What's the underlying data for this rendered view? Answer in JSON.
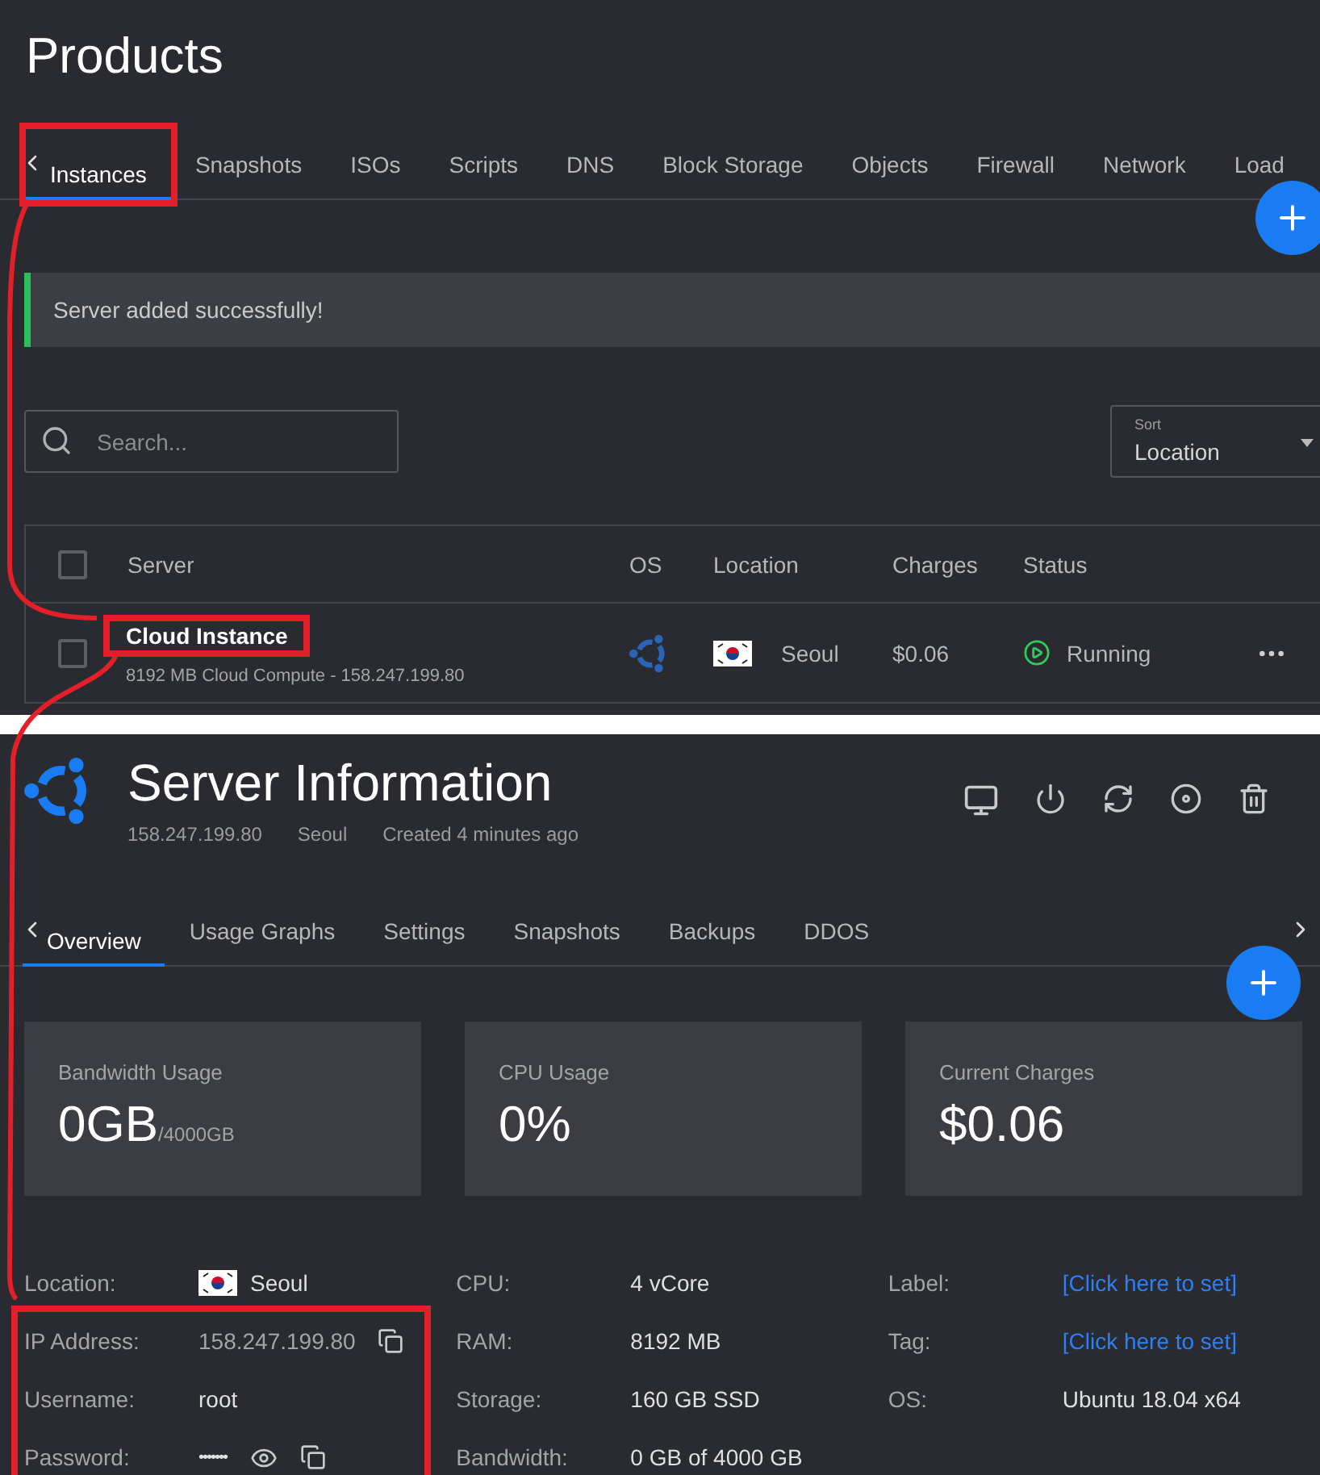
{
  "products": {
    "title": "Products",
    "tabs": [
      {
        "label": "Instances",
        "selected": true,
        "highlighted": true
      },
      {
        "label": "Snapshots",
        "selected": false,
        "highlighted": false
      },
      {
        "label": "ISOs",
        "selected": false,
        "highlighted": false
      },
      {
        "label": "Scripts",
        "selected": false,
        "highlighted": false
      },
      {
        "label": "DNS",
        "selected": false,
        "highlighted": false
      },
      {
        "label": "Block Storage",
        "selected": false,
        "highlighted": false
      },
      {
        "label": "Objects",
        "selected": false,
        "highlighted": false
      },
      {
        "label": "Firewall",
        "selected": false,
        "highlighted": false
      },
      {
        "label": "Network",
        "selected": false,
        "highlighted": false
      },
      {
        "label": "Load",
        "selected": false,
        "highlighted": false
      }
    ],
    "alert": {
      "message": "Server added successfully!",
      "kind": "success"
    },
    "search": {
      "placeholder": "Search..."
    },
    "sort": {
      "label": "Sort",
      "value": "Location"
    },
    "table": {
      "header_checked": false,
      "columns": [
        "Server",
        "OS",
        "Location",
        "Charges",
        "Status"
      ],
      "rows": [
        {
          "checked": false,
          "name": "Cloud Instance",
          "highlighted": true,
          "detail": "8192 MB Cloud Compute - 158.247.199.80",
          "location": "Seoul",
          "charges": "$0.06",
          "status": {
            "label": "Running",
            "kind": "running"
          }
        }
      ]
    }
  },
  "server": {
    "title": "Server Information",
    "meta": [
      "158.247.199.80",
      "Seoul",
      "Created 4 minutes ago"
    ],
    "tabs": [
      {
        "label": "Overview",
        "selected": true
      },
      {
        "label": "Usage Graphs",
        "selected": false
      },
      {
        "label": "Settings",
        "selected": false
      },
      {
        "label": "Snapshots",
        "selected": false
      },
      {
        "label": "Backups",
        "selected": false
      },
      {
        "label": "DDOS",
        "selected": false
      }
    ],
    "stats": [
      {
        "label": "Bandwidth Usage",
        "value": "0GB",
        "unit": "/4000GB"
      },
      {
        "label": "CPU Usage",
        "value": "0%"
      },
      {
        "label": "Current Charges",
        "value": "$0.06"
      }
    ],
    "details": [
      [
        {
          "label": "Location:",
          "value": "Seoul",
          "kind": "flag",
          "highlighted": false
        },
        {
          "label": "IP Address:",
          "value": "158.247.199.80",
          "kind": "copy",
          "highlighted": true
        },
        {
          "label": "Username:",
          "value": "root",
          "kind": "text",
          "highlighted": true
        },
        {
          "label": "Password:",
          "value": "•••••••",
          "kind": "password",
          "highlighted": true
        }
      ],
      [
        {
          "label": "CPU:",
          "value": "4 vCore",
          "kind": "text",
          "highlighted": false
        },
        {
          "label": "RAM:",
          "value": "8192 MB",
          "kind": "text",
          "highlighted": false
        },
        {
          "label": "Storage:",
          "value": "160 GB SSD",
          "kind": "text",
          "highlighted": false
        },
        {
          "label": "Bandwidth:",
          "value": "0 GB of 4000 GB",
          "kind": "text",
          "highlighted": false
        }
      ],
      [
        {
          "label": "Label:",
          "value": "[Click here to set]",
          "kind": "link",
          "highlighted": false
        },
        {
          "label": "Tag:",
          "value": "[Click here to set]",
          "kind": "link",
          "highlighted": false
        },
        {
          "label": "OS:",
          "value": "Ubuntu 18.04 x64",
          "kind": "text",
          "highlighted": false
        }
      ]
    ]
  }
}
